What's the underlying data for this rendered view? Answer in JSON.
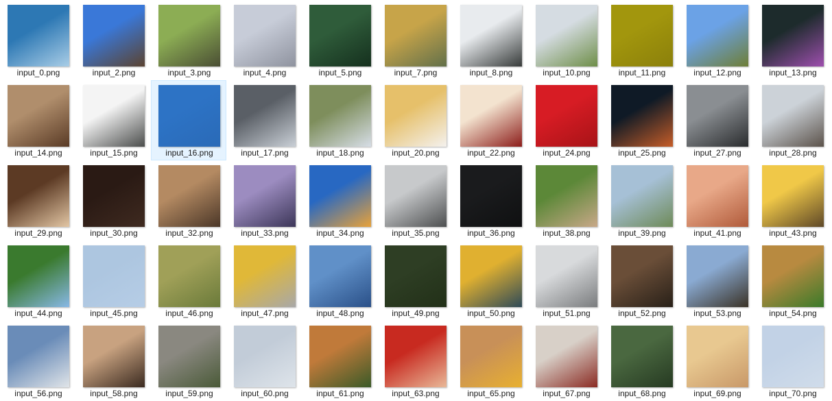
{
  "explorer": {
    "view": "large-icons",
    "selected_file": "input_16.png",
    "files": [
      {
        "name": "input_0.png",
        "colors": [
          "#2d78b4",
          "#a9cde6"
        ]
      },
      {
        "name": "input_2.png",
        "colors": [
          "#3a78d8",
          "#5b4330"
        ]
      },
      {
        "name": "input_3.png",
        "colors": [
          "#8cad54",
          "#4a4e34"
        ]
      },
      {
        "name": "input_4.png",
        "colors": [
          "#c7ccd8",
          "#8f939f"
        ]
      },
      {
        "name": "input_5.png",
        "colors": [
          "#2f5c3a",
          "#15301e"
        ]
      },
      {
        "name": "input_7.png",
        "colors": [
          "#c7a449",
          "#62704a"
        ]
      },
      {
        "name": "input_8.png",
        "colors": [
          "#e8ebee",
          "#373b3a"
        ]
      },
      {
        "name": "input_10.png",
        "colors": [
          "#d5dce2",
          "#6e8e48"
        ]
      },
      {
        "name": "input_11.png",
        "colors": [
          "#a2960d",
          "#8b800b"
        ]
      },
      {
        "name": "input_12.png",
        "colors": [
          "#6ba2e6",
          "#6e7e36"
        ]
      },
      {
        "name": "input_13.png",
        "colors": [
          "#1d2b2c",
          "#9e4fae"
        ]
      },
      {
        "name": "input_14.png",
        "colors": [
          "#b08e6c",
          "#5a3b26"
        ]
      },
      {
        "name": "input_15.png",
        "colors": [
          "#f4f4f4",
          "#4b4d4c"
        ]
      },
      {
        "name": "input_16.png",
        "colors": [
          "#2d73c5",
          "#2a6ab7"
        ]
      },
      {
        "name": "input_17.png",
        "colors": [
          "#5a5f66",
          "#c9cfd6"
        ]
      },
      {
        "name": "input_18.png",
        "colors": [
          "#7e8e5c",
          "#d6dde6"
        ]
      },
      {
        "name": "input_20.png",
        "colors": [
          "#e6c06a",
          "#f4f1ee"
        ]
      },
      {
        "name": "input_22.png",
        "colors": [
          "#f3e3cf",
          "#8c1d1a"
        ]
      },
      {
        "name": "input_24.png",
        "colors": [
          "#d71c24",
          "#a71317"
        ]
      },
      {
        "name": "input_25.png",
        "colors": [
          "#0f1a26",
          "#c65d28"
        ]
      },
      {
        "name": "input_27.png",
        "colors": [
          "#8a8e92",
          "#2a2c2e"
        ]
      },
      {
        "name": "input_28.png",
        "colors": [
          "#ccd2d8",
          "#5b524a"
        ]
      },
      {
        "name": "input_29.png",
        "colors": [
          "#5c3a24",
          "#e2c6a4"
        ]
      },
      {
        "name": "input_30.png",
        "colors": [
          "#2a1a14",
          "#3f2a20"
        ]
      },
      {
        "name": "input_32.png",
        "colors": [
          "#b48a62",
          "#4b3728"
        ]
      },
      {
        "name": "input_33.png",
        "colors": [
          "#9c8cc0",
          "#3c3658"
        ]
      },
      {
        "name": "input_34.png",
        "colors": [
          "#2868c2",
          "#e8a23a"
        ]
      },
      {
        "name": "input_35.png",
        "colors": [
          "#c7c9cb",
          "#4d4f50"
        ]
      },
      {
        "name": "input_36.png",
        "colors": [
          "#1a1b1d",
          "#0f1011"
        ]
      },
      {
        "name": "input_38.png",
        "colors": [
          "#5c8838",
          "#c8a888"
        ]
      },
      {
        "name": "input_39.png",
        "colors": [
          "#a6c0d6",
          "#6e8a58"
        ]
      },
      {
        "name": "input_41.png",
        "colors": [
          "#e8a888",
          "#b05a3a"
        ]
      },
      {
        "name": "input_43.png",
        "colors": [
          "#f0c848",
          "#5e4828"
        ]
      },
      {
        "name": "input_44.png",
        "colors": [
          "#3a7a2e",
          "#88b8e6"
        ]
      },
      {
        "name": "input_45.png",
        "colors": [
          "#adc6e0",
          "#b6cde6"
        ]
      },
      {
        "name": "input_46.png",
        "colors": [
          "#a0a058",
          "#6a7a3a"
        ]
      },
      {
        "name": "input_47.png",
        "colors": [
          "#e0b838",
          "#a8a8a8"
        ]
      },
      {
        "name": "input_48.png",
        "colors": [
          "#6090c8",
          "#2a5088"
        ]
      },
      {
        "name": "input_49.png",
        "colors": [
          "#2e3e24",
          "#223018"
        ]
      },
      {
        "name": "input_50.png",
        "colors": [
          "#e0b030",
          "#2e4a58"
        ]
      },
      {
        "name": "input_51.png",
        "colors": [
          "#d8dadc",
          "#7a7c7e"
        ]
      },
      {
        "name": "input_52.png",
        "colors": [
          "#6a4e38",
          "#282018"
        ]
      },
      {
        "name": "input_53.png",
        "colors": [
          "#8aaad2",
          "#3a3226"
        ]
      },
      {
        "name": "input_54.png",
        "colors": [
          "#b88a40",
          "#3a7a2a"
        ]
      },
      {
        "name": "input_56.png",
        "colors": [
          "#6a8cb8",
          "#e0e4e8"
        ]
      },
      {
        "name": "input_58.png",
        "colors": [
          "#c8a280",
          "#3a2a20"
        ]
      },
      {
        "name": "input_59.png",
        "colors": [
          "#8a8880",
          "#4a5a38"
        ]
      },
      {
        "name": "input_60.png",
        "colors": [
          "#c2ccd8",
          "#dee4ea"
        ]
      },
      {
        "name": "input_61.png",
        "colors": [
          "#c07a3a",
          "#3a5a28"
        ]
      },
      {
        "name": "input_63.png",
        "colors": [
          "#c82a20",
          "#e8b898"
        ]
      },
      {
        "name": "input_65.png",
        "colors": [
          "#c89058",
          "#e8b030"
        ]
      },
      {
        "name": "input_67.png",
        "colors": [
          "#d8d0c8",
          "#8a2a22"
        ]
      },
      {
        "name": "input_68.png",
        "colors": [
          "#4a6840",
          "#263a22"
        ]
      },
      {
        "name": "input_69.png",
        "colors": [
          "#e8c890",
          "#c89868"
        ]
      },
      {
        "name": "input_70.png",
        "colors": [
          "#c2d2e6",
          "#d0dcea"
        ]
      }
    ]
  }
}
